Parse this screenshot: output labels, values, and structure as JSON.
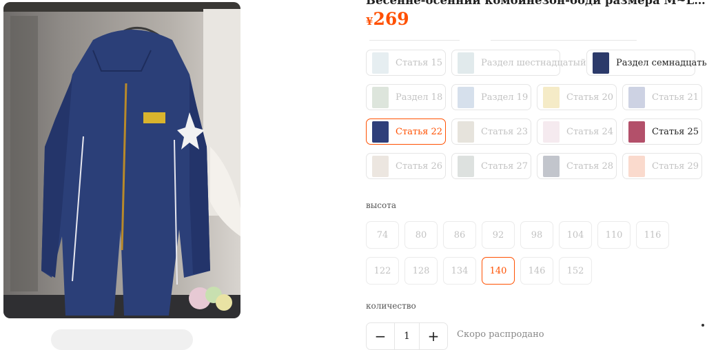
{
  "product": {
    "title": "Весенне-осенний комбинезон-боди размера M~LO дл...",
    "currency": "¥",
    "price": "269"
  },
  "variants": [
    {
      "label": "Статья 15",
      "state": "disabled",
      "thumb_color": "#b7cfd6"
    },
    {
      "label": "Раздел шестнадцатый",
      "state": "disabled",
      "thumb_color": "#a9c4c9"
    },
    {
      "label": "Раздел семнадцать",
      "state": "available",
      "thumb_color": "#2c3a6a"
    },
    {
      "label": "Раздел 18",
      "state": "disabled",
      "thumb_color": "#9fb59a"
    },
    {
      "label": "Раздел 19",
      "state": "disabled",
      "thumb_color": "#8aa6c9"
    },
    {
      "label": "Статья 20",
      "state": "disabled",
      "thumb_color": "#e2c55e"
    },
    {
      "label": "Статья 21",
      "state": "disabled",
      "thumb_color": "#6f7fb0"
    },
    {
      "label": "Статья 22",
      "state": "selected",
      "thumb_color": "#2f3f7a"
    },
    {
      "label": "Статья 23",
      "state": "disabled",
      "thumb_color": "#b8b09a"
    },
    {
      "label": "Статья 24",
      "state": "disabled",
      "thumb_color": "#e3c4d2"
    },
    {
      "label": "Статья 25",
      "state": "available",
      "thumb_color": "#b3506a"
    },
    {
      "label": "Статья 26",
      "state": "disabled",
      "thumb_color": "#c9b8a6"
    },
    {
      "label": "Статья 27",
      "state": "disabled",
      "thumb_color": "#9ea8a2"
    },
    {
      "label": "Статья 28",
      "state": "disabled",
      "thumb_color": "#4f5a6e"
    },
    {
      "label": "Статья 29",
      "state": "disabled",
      "thumb_color": "#f2956f"
    }
  ],
  "height_section": {
    "label": "высота",
    "sizes": [
      {
        "value": "74",
        "state": "disabled"
      },
      {
        "value": "80",
        "state": "disabled"
      },
      {
        "value": "86",
        "state": "disabled"
      },
      {
        "value": "92",
        "state": "disabled"
      },
      {
        "value": "98",
        "state": "disabled"
      },
      {
        "value": "104",
        "state": "disabled"
      },
      {
        "value": "110",
        "state": "disabled"
      },
      {
        "value": "116",
        "state": "disabled"
      },
      {
        "value": "122",
        "state": "disabled"
      },
      {
        "value": "128",
        "state": "disabled"
      },
      {
        "value": "134",
        "state": "disabled"
      },
      {
        "value": "140",
        "state": "selected"
      },
      {
        "value": "146",
        "state": "disabled"
      },
      {
        "value": "152",
        "state": "disabled"
      }
    ]
  },
  "quantity_section": {
    "label": "количество",
    "minus": "−",
    "value": "1",
    "plus": "+",
    "stock_note": "Скоро распродано"
  },
  "colors": {
    "accent": "#ff5000",
    "border": "#e5e5e5",
    "disabled_text": "#c2c2c2",
    "jacket": "#2b3f78"
  }
}
